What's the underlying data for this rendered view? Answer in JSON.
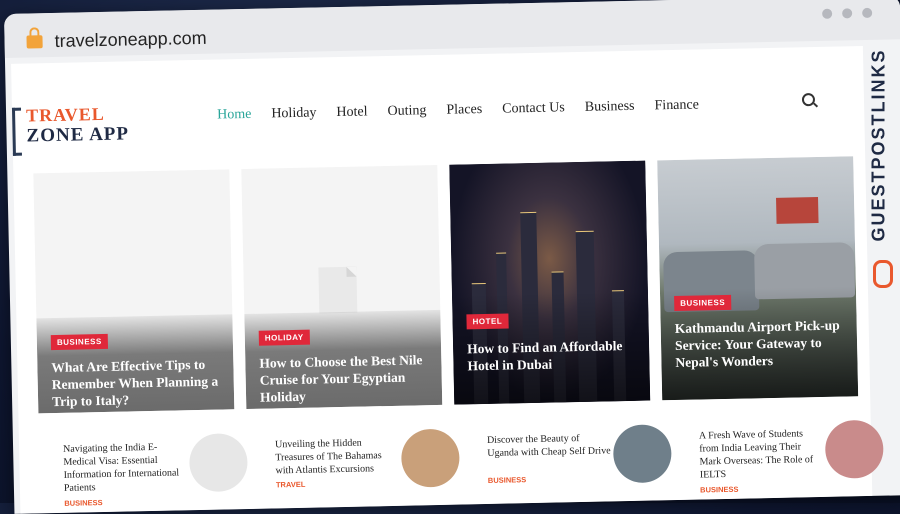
{
  "browser": {
    "url": "travelzoneapp.com"
  },
  "logo": {
    "line1": "TRAVEL",
    "line2": "ZONE APP"
  },
  "nav": {
    "items": [
      "Home",
      "Holiday",
      "Hotel",
      "Outing",
      "Places",
      "Contact Us",
      "Business",
      "Finance"
    ],
    "active": "Home"
  },
  "cards": [
    {
      "tag": "BUSINESS",
      "title": "What Are Effective Tips to Remember When Planning a Trip to Italy?"
    },
    {
      "tag": "HOLIDAY",
      "title": "How to Choose the Best Nile Cruise for Your Egyptian Holiday"
    },
    {
      "tag": "HOTEL",
      "title": "How to Find an Affordable Hotel in Dubai"
    },
    {
      "tag": "BUSINESS",
      "title": "Kathmandu Airport Pick-up Service: Your Gateway to Nepal's Wonders"
    }
  ],
  "list": [
    {
      "title": "Navigating the India E-Medical Visa: Essential Information for International Patients",
      "category": "BUSINESS"
    },
    {
      "title": "Unveiling the Hidden Treasures of The Bahamas with Atlantis Excursions",
      "category": "TRAVEL"
    },
    {
      "title": "Discover the Beauty of Uganda with Cheap Self Drive",
      "category": "BUSINESS"
    },
    {
      "title": "A Fresh Wave of Students from India Leaving Their Mark Overseas: The Role of IELTS",
      "category": "BUSINESS"
    }
  ],
  "watermark": "GUESTPOSTLINKS",
  "colors": {
    "accent": "#e9582d",
    "active_nav": "#2aa69a",
    "tag": "#e0283a"
  }
}
